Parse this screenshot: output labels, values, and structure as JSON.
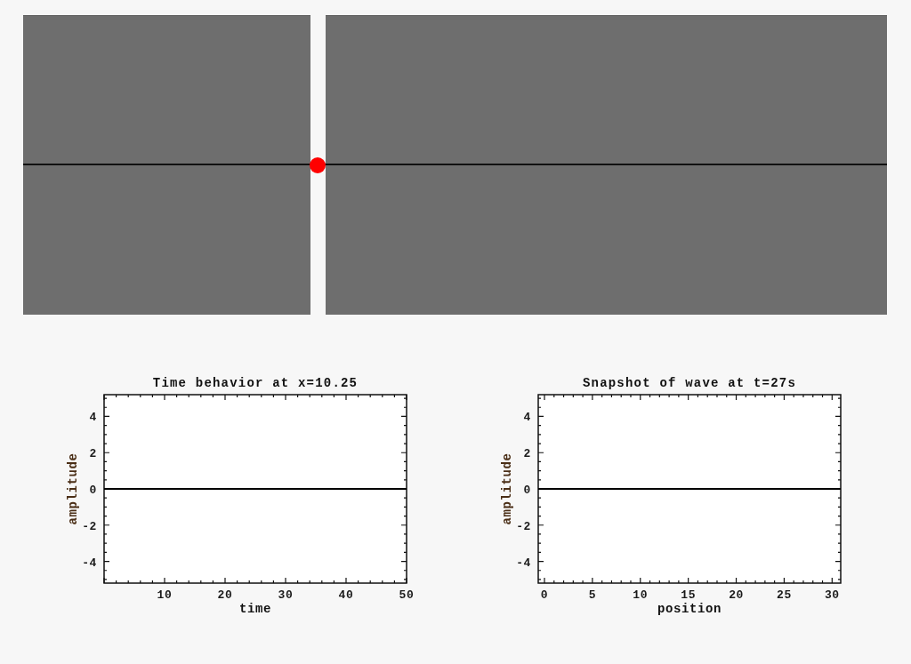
{
  "charts": [
    {
      "chart_data": {
        "type": "line",
        "title": "Time behavior at x=10.25",
        "xlabel": "time",
        "ylabel": "amplitude",
        "x": [
          0,
          50
        ],
        "series": [
          {
            "color": "#000000",
            "values": [
              0,
              0
            ]
          }
        ],
        "xlim": [
          0,
          50
        ],
        "ylim": [
          -5.2,
          5.2
        ],
        "xticks": [
          10,
          20,
          30,
          40,
          50
        ],
        "yticks": [
          -4,
          -2,
          0,
          2,
          4
        ]
      }
    },
    {
      "chart_data": {
        "type": "line",
        "title": "Snapshot of wave at t=27s",
        "xlabel": "position",
        "ylabel": "amplitude",
        "x": [
          -0.65,
          30.9
        ],
        "series": [
          {
            "color": "#000000",
            "values": [
              0,
              0
            ]
          }
        ],
        "xlim": [
          -0.65,
          30.9
        ],
        "ylim": [
          -5.2,
          5.2
        ],
        "xticks": [
          0,
          5,
          10,
          15,
          20,
          25,
          30
        ],
        "yticks": [
          -4,
          -2,
          0,
          2,
          4
        ]
      }
    }
  ]
}
